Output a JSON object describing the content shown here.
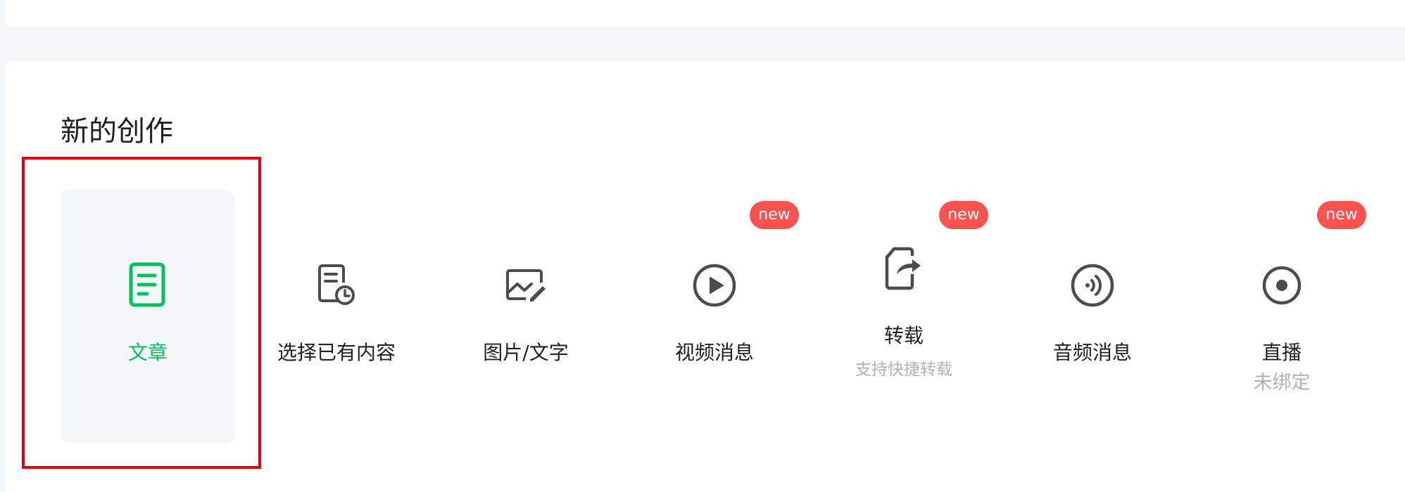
{
  "section": {
    "title": "新的创作"
  },
  "items": [
    {
      "label": "文章",
      "icon": "document-icon",
      "selected": true
    },
    {
      "label": "选择已有内容",
      "icon": "document-clock-icon"
    },
    {
      "label": "图片/文字",
      "icon": "image-edit-icon"
    },
    {
      "label": "视频消息",
      "icon": "play-circle-icon",
      "badge": "new"
    },
    {
      "label": "转载",
      "sublabel": "支持快捷转载",
      "icon": "share-document-icon",
      "badge": "new"
    },
    {
      "label": "音频消息",
      "icon": "audio-circle-icon"
    },
    {
      "label": "直播",
      "sublabel": "未绑定",
      "icon": "record-circle-icon",
      "badge": "new"
    }
  ],
  "colors": {
    "accent": "#07c160",
    "badge": "#fa5151",
    "icon": "#4c4c4c",
    "text": "#1f1f1f",
    "subtext": "#b2b2b2",
    "highlight_border": "#e60012"
  }
}
